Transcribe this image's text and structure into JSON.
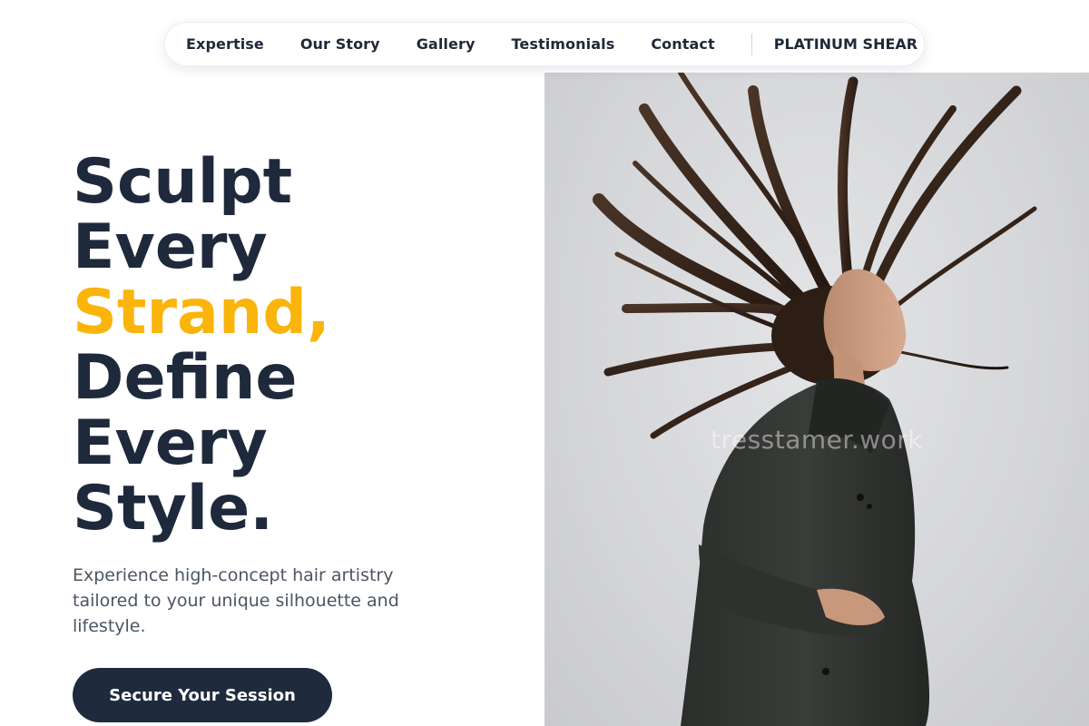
{
  "nav": {
    "links": [
      "Expertise",
      "Our Story",
      "Gallery",
      "Testimonials",
      "Contact"
    ],
    "brand": "PLATINUM SHEAR"
  },
  "hero": {
    "headline": {
      "line1": "Sculpt",
      "line2": "Every",
      "line3_accent": "Strand,",
      "line4": "Define",
      "line5": "Every",
      "line6": "Style."
    },
    "subtitle": "Experience high-concept hair artistry tailored to your unique silhouette and lifestyle.",
    "cta_label": "Secure Your Session",
    "image_watermark": "tresstamer.work"
  },
  "colors": {
    "accent": "#fbb40a",
    "dark": "#1e293b",
    "button": "#1f2a3d"
  }
}
